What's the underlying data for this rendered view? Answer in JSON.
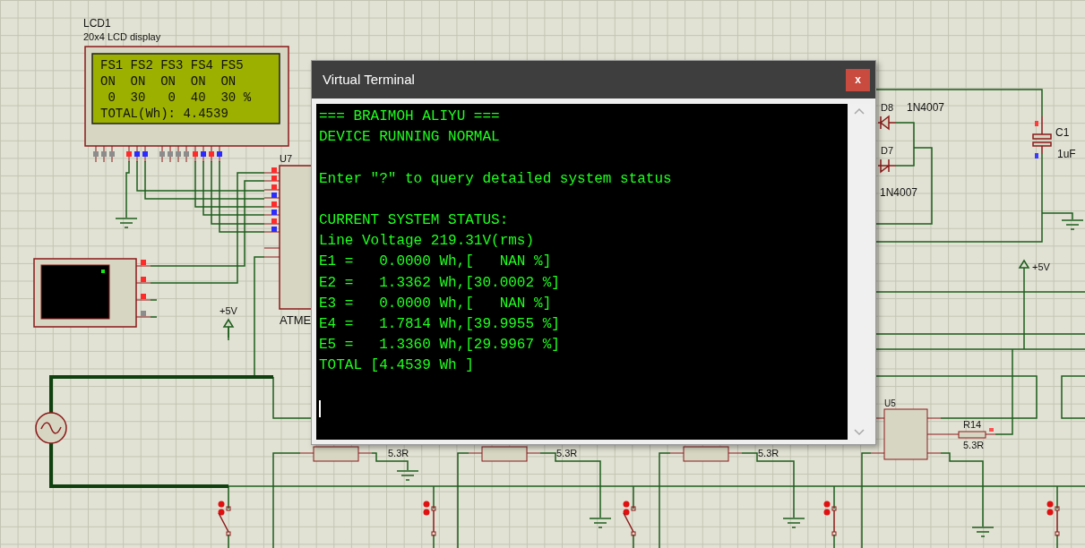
{
  "lcd": {
    "ref": "LCD1",
    "type": "20x4 LCD display",
    "lines": [
      "FS1 FS2 FS3 FS4 FS5",
      "ON  ON  ON  ON  ON",
      " 0  30   0  40  30 %",
      "TOTAL(Wh): 4.4539"
    ],
    "pins": [
      {
        "color": "#8c8c8c"
      },
      {
        "color": "#8c8c8c"
      },
      {
        "color": "#8c8c8c"
      },
      {
        "color": "#ff2b2b"
      },
      {
        "color": "#2b2bff"
      },
      {
        "color": "#2b2bff"
      },
      {
        "color": "#8c8c8c"
      },
      {
        "color": "#8c8c8c"
      },
      {
        "color": "#8c8c8c"
      },
      {
        "color": "#8c8c8c"
      },
      {
        "color": "#ff2b2b"
      },
      {
        "color": "#2b2bff"
      },
      {
        "color": "#ff2b2b"
      },
      {
        "color": "#2b2bff"
      }
    ]
  },
  "mcu": {
    "ref": "U7",
    "part": "ATME",
    "pins": [
      {
        "color": "#ff2b2b"
      },
      {
        "color": "#ff2b2b"
      },
      {
        "color": "#ff2b2b"
      },
      {
        "color": "#2b2bff"
      },
      {
        "color": "#ff2b2b"
      },
      {
        "color": "#2b2bff"
      },
      {
        "color": "#ff2b2b"
      },
      {
        "color": "#2b2bff"
      }
    ]
  },
  "mini_terminal": {
    "pins": [
      {
        "color": "#ff2b2b"
      },
      {
        "color": "#ff2b2b"
      },
      {
        "color": "#ff2b2b"
      },
      {
        "color": "#8c8c8c"
      }
    ]
  },
  "power_labels": [
    "+5V",
    "+5V"
  ],
  "diodes": [
    {
      "ref": "D8",
      "part": "1N4007"
    },
    {
      "ref": "D7",
      "part": "1N4007"
    }
  ],
  "capacitor": {
    "ref": "C1",
    "value": "1uF"
  },
  "sensors": [
    {
      "resistor": "5.3R"
    },
    {
      "resistor": "5.3R"
    },
    {
      "resistor": "5.3R"
    }
  ],
  "u5": {
    "ref": "U5",
    "resistor_ref": "R14",
    "resistor": "5.3R"
  },
  "switches": [
    {
      "closed": false
    },
    {
      "closed": true
    },
    {
      "closed": false
    },
    {
      "closed": true
    },
    {
      "closed": true
    }
  ],
  "terminal": {
    "title": "Virtual Terminal",
    "close": "x",
    "blocks": [
      [
        "=== BRAIMOH ALIYU ===",
        "DEVICE RUNNING NORMAL"
      ],
      [
        "Enter \"?\" to query detailed system status"
      ],
      [
        "CURRENT SYSTEM STATUS:",
        "Line Voltage 219.31V(rms)",
        "E1 =   0.0000 Wh,[   NAN %]",
        "E2 =   1.3362 Wh,[30.0002 %]",
        "E3 =   0.0000 Wh,[   NAN %]",
        "E4 =   1.7814 Wh,[39.9955 %]",
        "E5 =   1.3360 Wh,[29.9967 %]",
        "TOTAL [4.4539 Wh ]"
      ]
    ]
  }
}
